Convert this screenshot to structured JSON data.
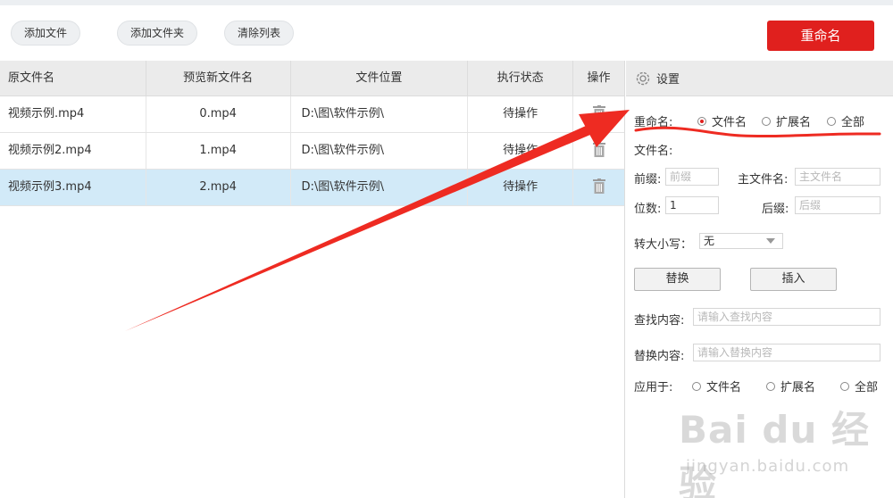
{
  "toolbar": {
    "add_file": "添加文件",
    "add_folder": "添加文件夹",
    "clear_list": "清除列表",
    "rename": "重命名"
  },
  "table": {
    "headers": [
      "原文件名",
      "预览新文件名",
      "文件位置",
      "执行状态",
      "操作"
    ],
    "rows": [
      {
        "name": "视频示例.mp4",
        "preview": "0.mp4",
        "location": "D:\\图\\软件示例\\",
        "status": "待操作"
      },
      {
        "name": "视频示例2.mp4",
        "preview": "1.mp4",
        "location": "D:\\图\\软件示例\\",
        "status": "待操作"
      },
      {
        "name": "视频示例3.mp4",
        "preview": "2.mp4",
        "location": "D:\\图\\软件示例\\",
        "status": "待操作"
      }
    ],
    "selected_row": 2
  },
  "settings": {
    "title": "设置",
    "rename_label": "重命名:",
    "rename_options": [
      "文件名",
      "扩展名",
      "全部"
    ],
    "rename_selected": "文件名",
    "filename_label": "文件名:",
    "prefix_label": "前缀:",
    "prefix_placeholder": "前缀",
    "main_name_label": "主文件名:",
    "main_name_placeholder": "主文件名",
    "digits_label": "位数:",
    "digits_value": "1",
    "suffix_label": "后缀:",
    "suffix_placeholder": "后缀",
    "case_label": "转大小写：",
    "case_value": "无",
    "replace_btn": "替换",
    "insert_btn": "插入",
    "find_label": "查找内容:",
    "find_placeholder": "请输入查找内容",
    "replace_label": "替换内容:",
    "replace_placeholder": "请输入替换内容",
    "apply_label": "应用于:",
    "apply_options": [
      "文件名",
      "扩展名",
      "全部"
    ]
  },
  "watermark": {
    "brand": "Bai du 经验",
    "url": "jingyan.baidu.com"
  },
  "colors": {
    "accent": "#e0201e",
    "selected_row": "#d2eaf8",
    "header_bg": "#ebebeb"
  }
}
